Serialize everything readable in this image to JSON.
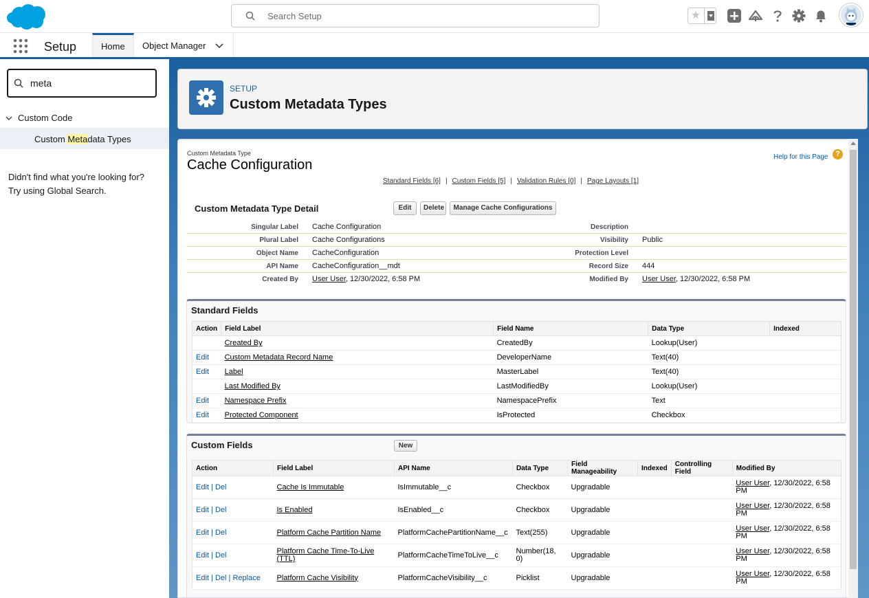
{
  "header": {
    "search_placeholder": "Search Setup"
  },
  "nav": {
    "app_title": "Setup",
    "tabs": [
      {
        "label": "Home"
      },
      {
        "label": "Object Manager"
      }
    ]
  },
  "sidebar": {
    "quickfind_value": "meta",
    "group_label": "Custom Code",
    "item_pre": "Custom ",
    "item_hl": "Meta",
    "item_post": "data Types",
    "not_found_line1": "Didn't find what you're looking for?",
    "not_found_line2": "Try using Global Search."
  },
  "page_header": {
    "breadcrumb": "SETUP",
    "title": "Custom Metadata Types"
  },
  "record": {
    "type_label": "Custom Metadata Type",
    "title": "Cache Configuration",
    "help_link": "Help for this Page",
    "related_links": [
      "Standard Fields [6]",
      "Custom Fields [5]",
      "Validation Rules [0]",
      "Page Layouts [1]"
    ],
    "detail_title": "Custom Metadata Type Detail",
    "buttons": {
      "edit": "Edit",
      "delete": "Delete",
      "manage": "Manage Cache Configurations"
    },
    "details": {
      "singular_label": {
        "label": "Singular Label",
        "value": "Cache Configuration"
      },
      "plural_label": {
        "label": "Plural Label",
        "value": "Cache Configurations"
      },
      "object_name": {
        "label": "Object Name",
        "value": "CacheConfiguration"
      },
      "api_name": {
        "label": "API Name",
        "value": "CacheConfiguration__mdt"
      },
      "created_by": {
        "label": "Created By",
        "user": "User User",
        "date": ", 12/30/2022, 6:58 PM"
      },
      "description": {
        "label": "Description",
        "value": ""
      },
      "visibility": {
        "label": "Visibility",
        "value": "Public"
      },
      "protection_level": {
        "label": "Protection Level",
        "value": ""
      },
      "record_size": {
        "label": "Record Size",
        "value": "444"
      },
      "modified_by": {
        "label": "Modified By",
        "user": "User User",
        "date": ", 12/30/2022, 6:58 PM"
      }
    }
  },
  "standard_fields": {
    "title": "Standard Fields",
    "columns": [
      "Action",
      "Field Label",
      "Field Name",
      "Data Type",
      "Indexed"
    ],
    "rows": [
      {
        "action": "",
        "label": "Created By",
        "name": "CreatedBy",
        "type": "Lookup(User)"
      },
      {
        "action": "Edit",
        "label": "Custom Metadata Record Name",
        "name": "DeveloperName",
        "type": "Text(40)"
      },
      {
        "action": "Edit",
        "label": "Label",
        "name": "MasterLabel",
        "type": "Text(40)"
      },
      {
        "action": "",
        "label": "Last Modified By",
        "name": "LastModifiedBy",
        "type": "Lookup(User)"
      },
      {
        "action": "Edit",
        "label": "Namespace Prefix",
        "name": "NamespacePrefix",
        "type": "Text"
      },
      {
        "action": "Edit",
        "label": "Protected Component",
        "name": "IsProtected",
        "type": "Checkbox"
      }
    ]
  },
  "custom_fields": {
    "title": "Custom Fields",
    "new_button": "New",
    "columns": [
      "Action",
      "Field Label",
      "API Name",
      "Data Type",
      "Field Manageability",
      "Indexed",
      "Controlling Field",
      "Modified By"
    ],
    "rows": [
      {
        "edit": "Edit",
        "del": "Del",
        "replace": "",
        "label": "Cache Is Immutable",
        "api": "IsImmutable__c",
        "type": "Checkbox",
        "manage": "Upgradable",
        "mod_user": "User User",
        "mod_date": ", 12/30/2022, 6:58 PM"
      },
      {
        "edit": "Edit",
        "del": "Del",
        "replace": "",
        "label": "Is Enabled",
        "api": "IsEnabled__c",
        "type": "Checkbox",
        "manage": "Upgradable",
        "mod_user": "User User",
        "mod_date": ", 12/30/2022, 6:58 PM"
      },
      {
        "edit": "Edit",
        "del": "Del",
        "replace": "",
        "label": "Platform Cache Partition Name",
        "api": "PlatformCachePartitionName__c",
        "type": "Text(255)",
        "manage": "Upgradable",
        "mod_user": "User User",
        "mod_date": ", 12/30/2022, 6:58 PM"
      },
      {
        "edit": "Edit",
        "del": "Del",
        "replace": "",
        "label": "Platform Cache Time-To-Live (TTL)",
        "api": "PlatformCacheTimeToLive__c",
        "type": "Number(18, 0)",
        "manage": "Upgradable",
        "mod_user": "User User",
        "mod_date": ", 12/30/2022, 6:58 PM"
      },
      {
        "edit": "Edit",
        "del": "Del",
        "replace": "Replace",
        "label": "Platform Cache Visibility",
        "api": "PlatformCacheVisibility__c",
        "type": "Picklist",
        "manage": "Upgradable",
        "mod_user": "User User",
        "mod_date": ", 12/30/2022, 6:58 PM"
      }
    ]
  },
  "icons": [
    "salesforce-logo",
    "search-icon",
    "star-icon",
    "add-icon",
    "trailhead-icon",
    "help-icon",
    "gear-icon",
    "bell-icon",
    "app-launcher-icon",
    "chevron-down-icon"
  ],
  "colors": {
    "brand": "#1b5f9e",
    "link": "#015ba7",
    "logo": "#00a1e0"
  }
}
